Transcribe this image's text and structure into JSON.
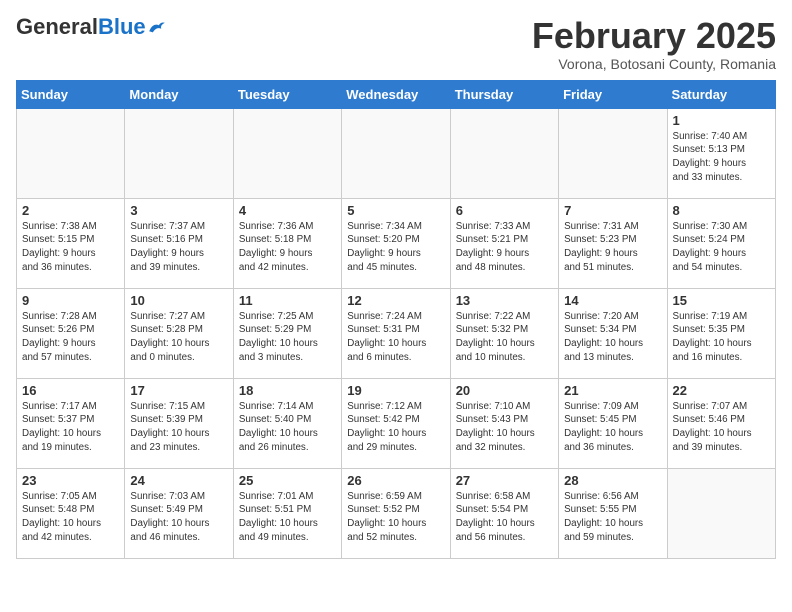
{
  "header": {
    "logo_general": "General",
    "logo_blue": "Blue",
    "title": "February 2025",
    "subtitle": "Vorona, Botosani County, Romania"
  },
  "days_of_week": [
    "Sunday",
    "Monday",
    "Tuesday",
    "Wednesday",
    "Thursday",
    "Friday",
    "Saturday"
  ],
  "weeks": [
    {
      "days": [
        {
          "num": "",
          "info": ""
        },
        {
          "num": "",
          "info": ""
        },
        {
          "num": "",
          "info": ""
        },
        {
          "num": "",
          "info": ""
        },
        {
          "num": "",
          "info": ""
        },
        {
          "num": "",
          "info": ""
        },
        {
          "num": "1",
          "info": "Sunrise: 7:40 AM\nSunset: 5:13 PM\nDaylight: 9 hours\nand 33 minutes."
        }
      ]
    },
    {
      "days": [
        {
          "num": "2",
          "info": "Sunrise: 7:38 AM\nSunset: 5:15 PM\nDaylight: 9 hours\nand 36 minutes."
        },
        {
          "num": "3",
          "info": "Sunrise: 7:37 AM\nSunset: 5:16 PM\nDaylight: 9 hours\nand 39 minutes."
        },
        {
          "num": "4",
          "info": "Sunrise: 7:36 AM\nSunset: 5:18 PM\nDaylight: 9 hours\nand 42 minutes."
        },
        {
          "num": "5",
          "info": "Sunrise: 7:34 AM\nSunset: 5:20 PM\nDaylight: 9 hours\nand 45 minutes."
        },
        {
          "num": "6",
          "info": "Sunrise: 7:33 AM\nSunset: 5:21 PM\nDaylight: 9 hours\nand 48 minutes."
        },
        {
          "num": "7",
          "info": "Sunrise: 7:31 AM\nSunset: 5:23 PM\nDaylight: 9 hours\nand 51 minutes."
        },
        {
          "num": "8",
          "info": "Sunrise: 7:30 AM\nSunset: 5:24 PM\nDaylight: 9 hours\nand 54 minutes."
        }
      ]
    },
    {
      "days": [
        {
          "num": "9",
          "info": "Sunrise: 7:28 AM\nSunset: 5:26 PM\nDaylight: 9 hours\nand 57 minutes."
        },
        {
          "num": "10",
          "info": "Sunrise: 7:27 AM\nSunset: 5:28 PM\nDaylight: 10 hours\nand 0 minutes."
        },
        {
          "num": "11",
          "info": "Sunrise: 7:25 AM\nSunset: 5:29 PM\nDaylight: 10 hours\nand 3 minutes."
        },
        {
          "num": "12",
          "info": "Sunrise: 7:24 AM\nSunset: 5:31 PM\nDaylight: 10 hours\nand 6 minutes."
        },
        {
          "num": "13",
          "info": "Sunrise: 7:22 AM\nSunset: 5:32 PM\nDaylight: 10 hours\nand 10 minutes."
        },
        {
          "num": "14",
          "info": "Sunrise: 7:20 AM\nSunset: 5:34 PM\nDaylight: 10 hours\nand 13 minutes."
        },
        {
          "num": "15",
          "info": "Sunrise: 7:19 AM\nSunset: 5:35 PM\nDaylight: 10 hours\nand 16 minutes."
        }
      ]
    },
    {
      "days": [
        {
          "num": "16",
          "info": "Sunrise: 7:17 AM\nSunset: 5:37 PM\nDaylight: 10 hours\nand 19 minutes."
        },
        {
          "num": "17",
          "info": "Sunrise: 7:15 AM\nSunset: 5:39 PM\nDaylight: 10 hours\nand 23 minutes."
        },
        {
          "num": "18",
          "info": "Sunrise: 7:14 AM\nSunset: 5:40 PM\nDaylight: 10 hours\nand 26 minutes."
        },
        {
          "num": "19",
          "info": "Sunrise: 7:12 AM\nSunset: 5:42 PM\nDaylight: 10 hours\nand 29 minutes."
        },
        {
          "num": "20",
          "info": "Sunrise: 7:10 AM\nSunset: 5:43 PM\nDaylight: 10 hours\nand 32 minutes."
        },
        {
          "num": "21",
          "info": "Sunrise: 7:09 AM\nSunset: 5:45 PM\nDaylight: 10 hours\nand 36 minutes."
        },
        {
          "num": "22",
          "info": "Sunrise: 7:07 AM\nSunset: 5:46 PM\nDaylight: 10 hours\nand 39 minutes."
        }
      ]
    },
    {
      "days": [
        {
          "num": "23",
          "info": "Sunrise: 7:05 AM\nSunset: 5:48 PM\nDaylight: 10 hours\nand 42 minutes."
        },
        {
          "num": "24",
          "info": "Sunrise: 7:03 AM\nSunset: 5:49 PM\nDaylight: 10 hours\nand 46 minutes."
        },
        {
          "num": "25",
          "info": "Sunrise: 7:01 AM\nSunset: 5:51 PM\nDaylight: 10 hours\nand 49 minutes."
        },
        {
          "num": "26",
          "info": "Sunrise: 6:59 AM\nSunset: 5:52 PM\nDaylight: 10 hours\nand 52 minutes."
        },
        {
          "num": "27",
          "info": "Sunrise: 6:58 AM\nSunset: 5:54 PM\nDaylight: 10 hours\nand 56 minutes."
        },
        {
          "num": "28",
          "info": "Sunrise: 6:56 AM\nSunset: 5:55 PM\nDaylight: 10 hours\nand 59 minutes."
        },
        {
          "num": "",
          "info": ""
        }
      ]
    }
  ]
}
